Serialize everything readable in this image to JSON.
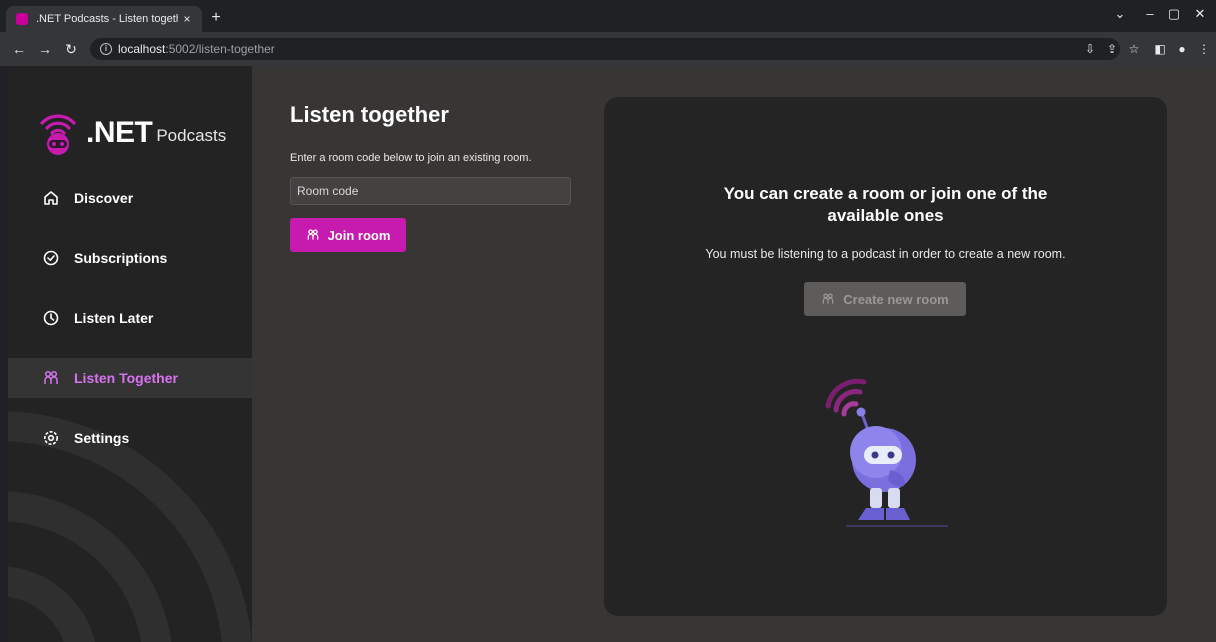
{
  "browser": {
    "tab_title": ".NET Podcasts - Listen together",
    "tab_close": "×",
    "new_tab": "+",
    "url_host": "localhost",
    "url_path": ":5002/listen-together"
  },
  "sidebar": {
    "brand": ".NET",
    "brand_sub": "Podcasts",
    "items": [
      {
        "label": "Discover"
      },
      {
        "label": "Subscriptions"
      },
      {
        "label": "Listen Later"
      },
      {
        "label": "Listen Together"
      },
      {
        "label": "Settings"
      }
    ],
    "active_index": 3
  },
  "main": {
    "title": "Listen together",
    "lead": "Enter a room code below to join an existing room.",
    "room_input_placeholder": "Room code",
    "room_input_value": "",
    "join_label": "Join room"
  },
  "panel": {
    "title": "You can create a room or join one of the available ones",
    "note": "You must be listening to a podcast in order to create a new room.",
    "create_label": "Create new room"
  },
  "colors": {
    "accent": "#c71bb0",
    "active_nav_text": "#d873f0",
    "sidebar_bg": "#232323",
    "main_bg": "#383634",
    "panel_bg": "#242424"
  }
}
